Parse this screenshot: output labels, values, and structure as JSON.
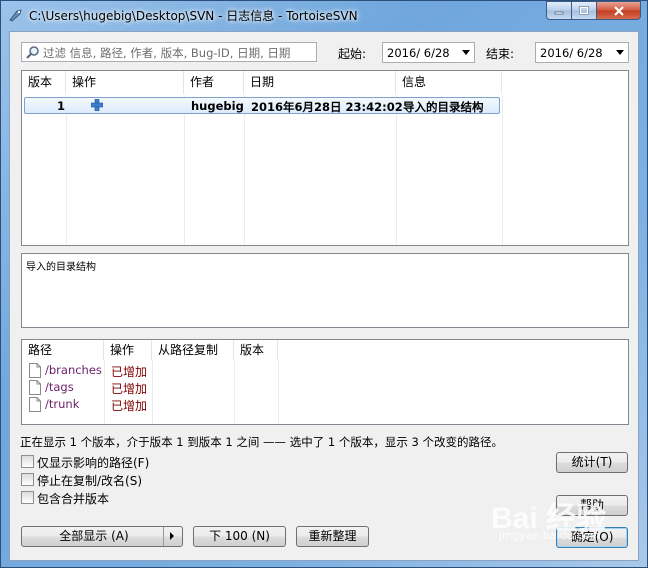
{
  "window": {
    "title": "C:\\Users\\hugebig\\Desktop\\SVN - 日志信息 - TortoiseSVN"
  },
  "filter": {
    "placeholder": "过滤 信息, 路径, 作者, 版本, Bug-ID, 日期, 日期",
    "start_label": "起始:",
    "start_value": "2016/  6/28",
    "end_label": "结束:",
    "end_value": "2016/  6/28"
  },
  "log_list": {
    "columns": [
      "版本",
      "操作",
      "作者",
      "日期",
      "信息"
    ],
    "rows": [
      {
        "revision": "1",
        "action_icon": "plus-icon",
        "author": "hugebig",
        "date": "2016年6月28日 23:42:02",
        "message": "导入的目录结构"
      }
    ]
  },
  "message_box": {
    "text": "导入的目录结构"
  },
  "paths": {
    "columns": [
      "路径",
      "操作",
      "从路径复制",
      "版本"
    ],
    "rows": [
      {
        "path": "/branches",
        "action": "已增加"
      },
      {
        "path": "/tags",
        "action": "已增加"
      },
      {
        "path": "/trunk",
        "action": "已增加"
      }
    ]
  },
  "status_text": "正在显示 1 个版本，介于版本 1 到版本 1 之间 —— 选中了 1 个版本，显示 3 个改变的路径。",
  "options": [
    {
      "label": "仅显示影响的路径(F)",
      "checked": false
    },
    {
      "label": "停止在复制/改名(S)",
      "checked": false
    },
    {
      "label": "包含合并版本",
      "checked": false
    }
  ],
  "buttons": {
    "stats": "统计(T)",
    "help": "帮助",
    "ok": "确定(O)",
    "show_all": "全部显示 (A)",
    "next100": "下 100 (N)",
    "refresh": "重新整理"
  },
  "watermark": {
    "logo": "Bai 经验",
    "url": "jingyan.baidu.com"
  }
}
